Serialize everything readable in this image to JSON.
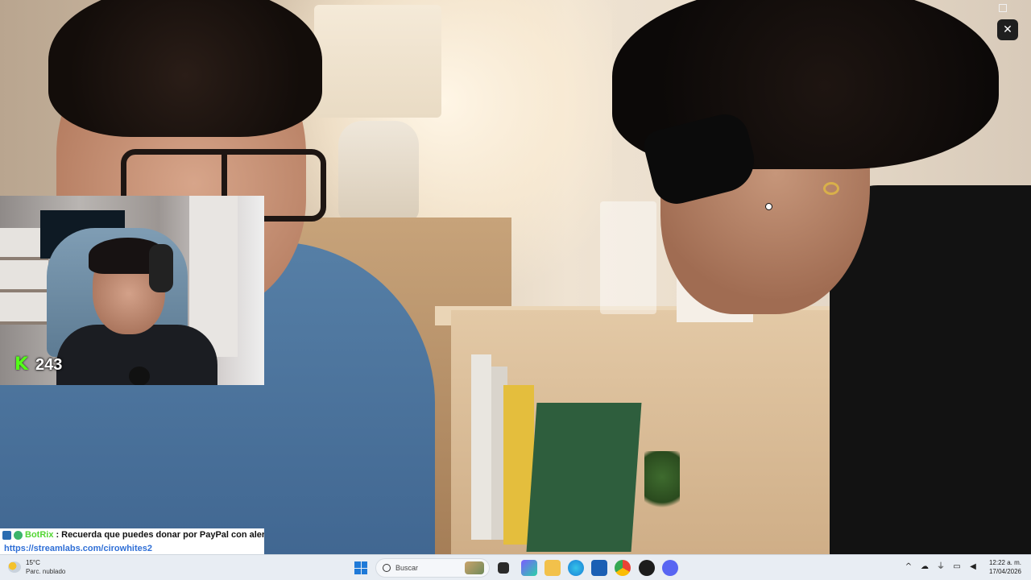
{
  "overlay": {
    "viewer_count": "243",
    "kick_logo_glyph": "K",
    "kick_color": "#53fc18"
  },
  "chat": {
    "username": "BotRix",
    "separator": ":",
    "message": "Recuerda que puedes donar por PayPal con alerta",
    "link": "https://streamlabs.com/cirowhites2",
    "username_color": "#53d633",
    "link_color": "#2f6fd6"
  },
  "window": {
    "close_glyph": "✕"
  },
  "taskbar": {
    "weather": {
      "temperature": "15°C",
      "description": "Parc. nublado"
    },
    "search_placeholder": "Buscar",
    "apps": [
      "start-icon",
      "search-icon",
      "task-view-icon",
      "store-icon",
      "file-explorer-icon",
      "edge-icon",
      "microsoft-store-icon",
      "chrome-icon",
      "obs-icon",
      "discord-icon"
    ],
    "tray": {
      "chevron": "^",
      "network": "☁",
      "mic": "⏚",
      "display": "▭",
      "volume": "◀"
    },
    "clock": {
      "time": "12:22 a. m.",
      "date": "17/04/2026"
    }
  }
}
